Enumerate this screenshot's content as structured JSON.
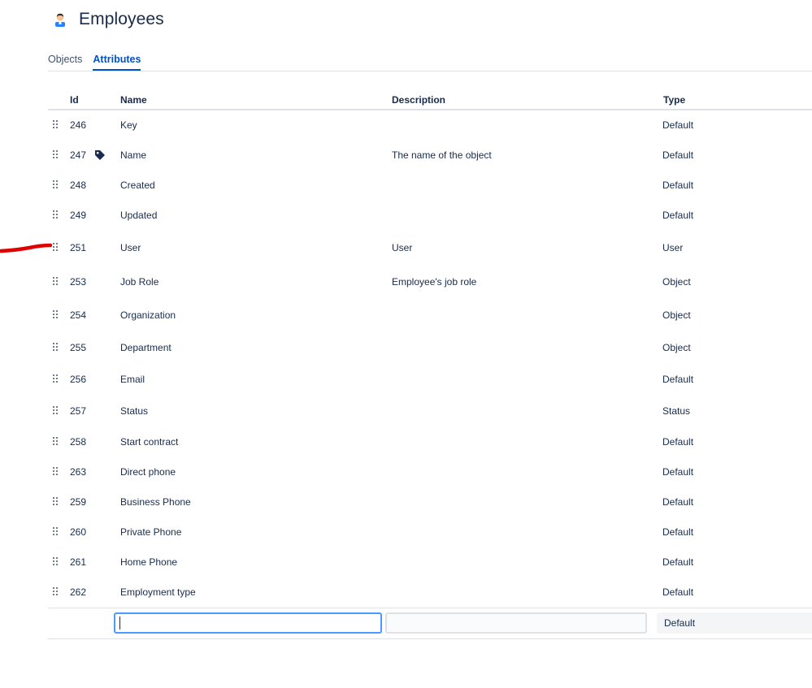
{
  "header": {
    "title": "Employees",
    "icon": "user-avatar-icon"
  },
  "tabs": [
    {
      "label": "Objects",
      "active": false
    },
    {
      "label": "Attributes",
      "active": true
    }
  ],
  "table": {
    "columns": {
      "id": "Id",
      "name": "Name",
      "description": "Description",
      "type": "Type"
    },
    "rows": [
      {
        "id": "246",
        "name": "Key",
        "description": "",
        "type": "Default",
        "label_attribute": false
      },
      {
        "id": "247",
        "name": "Name",
        "description": "The name of the object",
        "type": "Default",
        "label_attribute": true
      },
      {
        "id": "248",
        "name": "Created",
        "description": "",
        "type": "Default",
        "label_attribute": false
      },
      {
        "id": "249",
        "name": "Updated",
        "description": "",
        "type": "Default",
        "label_attribute": false
      },
      {
        "id": "251",
        "name": "User",
        "description": "User",
        "type": "User",
        "label_attribute": false
      },
      {
        "id": "253",
        "name": "Job Role",
        "description": "Employee's job role",
        "type": "Object",
        "label_attribute": false
      },
      {
        "id": "254",
        "name": "Organization",
        "description": "",
        "type": "Object",
        "label_attribute": false
      },
      {
        "id": "255",
        "name": "Department",
        "description": "",
        "type": "Object",
        "label_attribute": false
      },
      {
        "id": "256",
        "name": "Email",
        "description": "",
        "type": "Default",
        "label_attribute": false
      },
      {
        "id": "257",
        "name": "Status",
        "description": "",
        "type": "Status",
        "label_attribute": false
      },
      {
        "id": "258",
        "name": "Start contract",
        "description": "",
        "type": "Default",
        "label_attribute": false
      },
      {
        "id": "263",
        "name": "Direct phone",
        "description": "",
        "type": "Default",
        "label_attribute": false
      },
      {
        "id": "259",
        "name": "Business Phone",
        "description": "",
        "type": "Default",
        "label_attribute": false
      },
      {
        "id": "260",
        "name": "Private Phone",
        "description": "",
        "type": "Default",
        "label_attribute": false
      },
      {
        "id": "261",
        "name": "Home Phone",
        "description": "",
        "type": "Default",
        "label_attribute": false
      },
      {
        "id": "262",
        "name": "Employment type",
        "description": "",
        "type": "Default",
        "label_attribute": false
      }
    ]
  },
  "new_attribute": {
    "name_value": "",
    "description_value": "",
    "type_value": "Default"
  },
  "colors": {
    "accent": "#0052cc",
    "text": "#172b4d",
    "annotation": "#e00000"
  }
}
